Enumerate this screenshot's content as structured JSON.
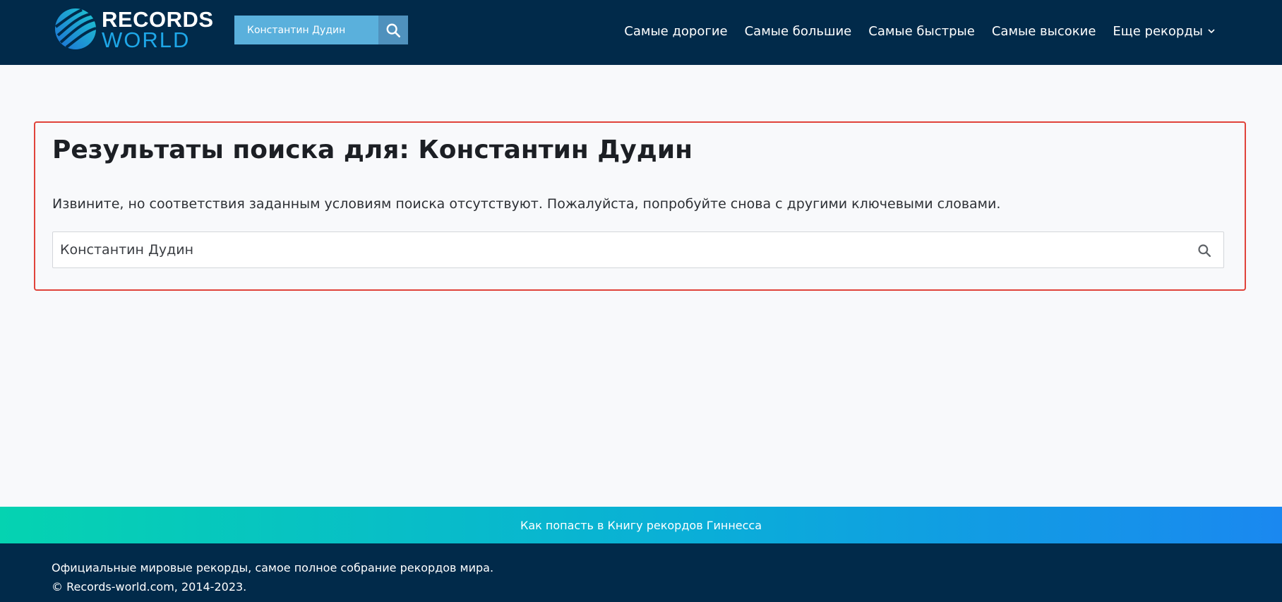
{
  "header": {
    "logo_line1": "RECORDS",
    "logo_line2": "WORLD",
    "search_value": "Константин Дудин",
    "nav": [
      {
        "label": "Самые дорогие"
      },
      {
        "label": "Самые большие"
      },
      {
        "label": "Самые быстрые"
      },
      {
        "label": "Самые высокие"
      },
      {
        "label": "Еще рекорды"
      }
    ]
  },
  "main": {
    "title": "Результаты поиска для: Константин Дудин",
    "notice": "Извините, но соответствия заданным условиям поиска отсутствуют. Пожалуйста, попробуйте снова с другими ключевыми словами.",
    "search_value": "Константин Дудин"
  },
  "promo": {
    "link": "Как попасть в Книгу рекордов Гиннесса"
  },
  "footer": {
    "line1": "Официальные мировые рекорды, самое полное собрание рекордов мира.",
    "line2": "© Records-world.com, 2014-2023."
  },
  "colors": {
    "header_bg": "#012a4a",
    "accent_blue": "#1ea7e8",
    "highlight_border": "#e0433a",
    "promo_start": "#05d3b1",
    "promo_end": "#1a88f0"
  },
  "icons": {
    "logo": "globe-logo-icon",
    "header_search": "search-icon",
    "nav_more": "chevron-down-icon",
    "main_search": "search-icon"
  }
}
